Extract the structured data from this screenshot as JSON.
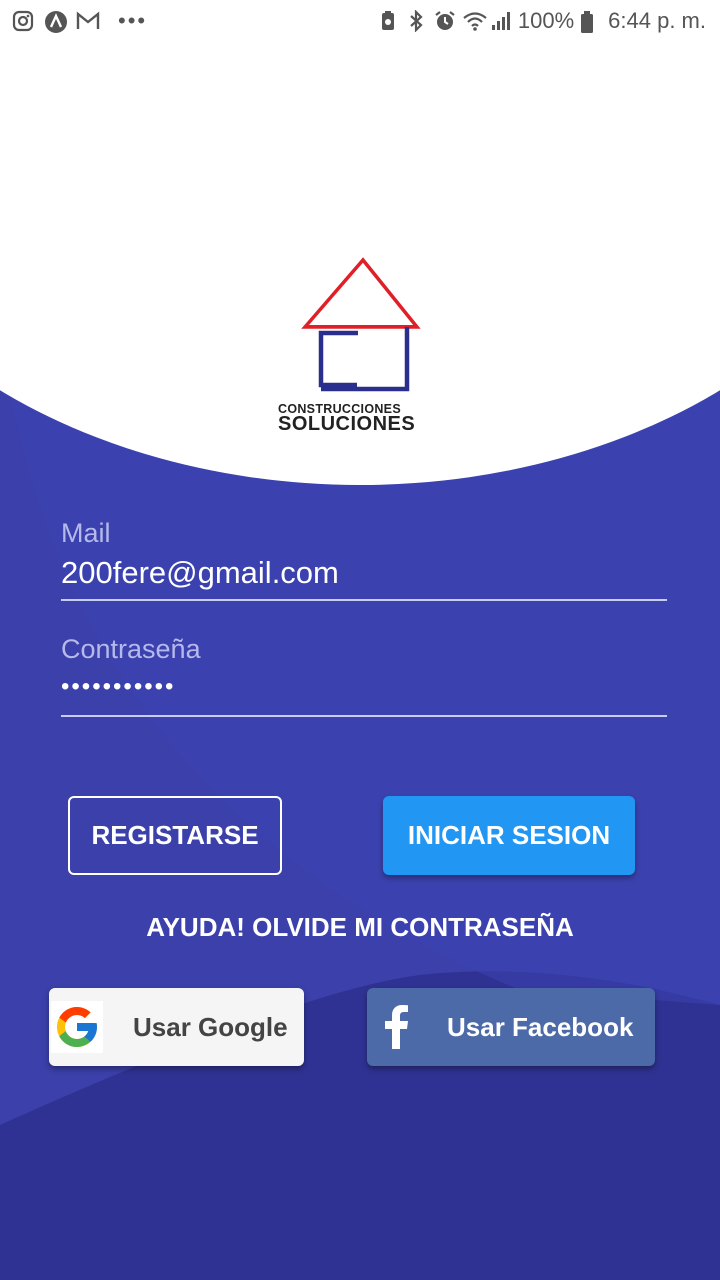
{
  "status_bar": {
    "left_icons": [
      "instagram-icon",
      "arc-app-icon",
      "gmail-icon"
    ],
    "more": "•••",
    "right_icons": [
      "battery-saver-icon",
      "bluetooth-icon",
      "alarm-icon",
      "wifi-icon",
      "signal-icon"
    ],
    "battery_percent": "100%",
    "time": "6:44 p. m."
  },
  "logo": {
    "line1": "CONSTRUCCIONES",
    "line2": "SOLUCIONES",
    "roof_color": "#e02028",
    "body_color": "#2a2e8c"
  },
  "form": {
    "mail": {
      "label": "Mail",
      "value": "200fere@gmail.com"
    },
    "password": {
      "label": "Contraseña",
      "value": "•••••••••••"
    }
  },
  "buttons": {
    "register": "REGISTARSE",
    "login": "INICIAR SESION",
    "forgot": "AYUDA! OLVIDE MI CONTRASEÑA",
    "google": "Usar Google",
    "facebook": "Usar Facebook"
  },
  "colors": {
    "background_dark": "#2f3292",
    "background_mid": "#3a3fa6",
    "login_button": "#2196f3",
    "facebook_button": "#4c69a8",
    "google_button": "#f5f5f5"
  }
}
